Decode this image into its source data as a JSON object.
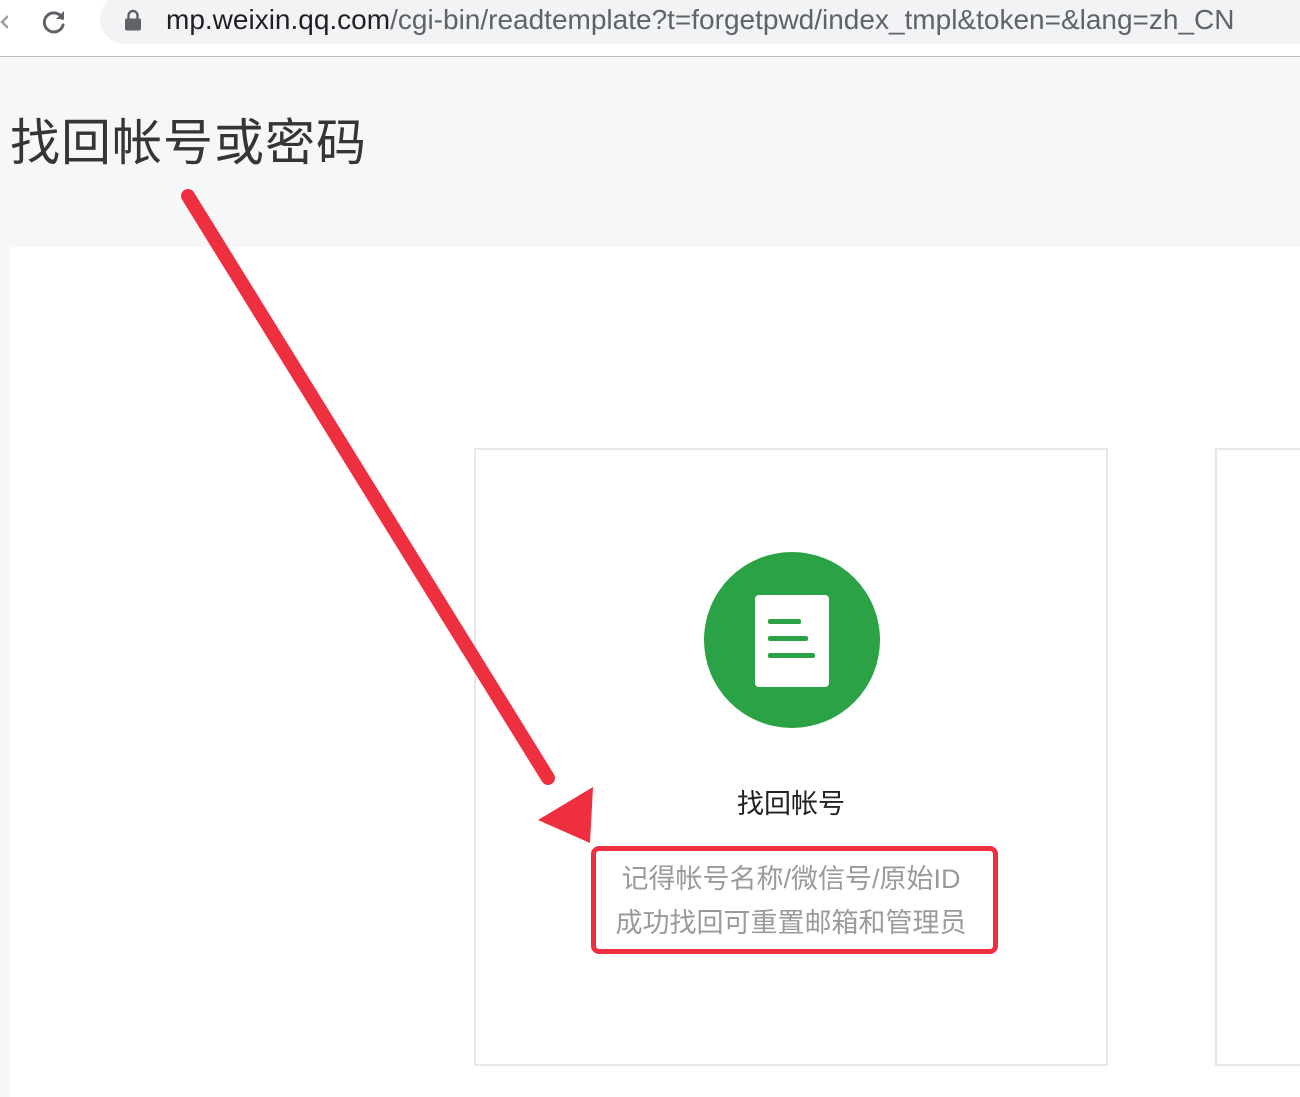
{
  "browser": {
    "url_host": "mp.weixin.qq.com",
    "url_path": "/cgi-bin/readtemplate?t=forgetpwd/index_tmpl&token=&lang=zh_CN"
  },
  "page": {
    "title": "找回帐号或密码"
  },
  "options": [
    {
      "icon": "document-icon",
      "title": "找回帐号",
      "description_lines": [
        "记得帐号名称/微信号/原始ID",
        "成功找回可重置邮箱和管理员"
      ]
    }
  ],
  "colors": {
    "accent_green": "#2ba245",
    "annotation_red": "#ee2f3f",
    "page_background": "#f6f7f9"
  }
}
